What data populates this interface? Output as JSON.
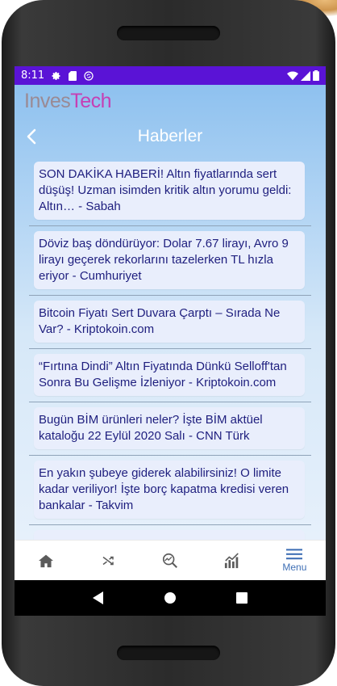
{
  "status": {
    "time": "8:11"
  },
  "app": {
    "brand_part1": "Inves",
    "brand_part2": "Tech",
    "title": "Haberler"
  },
  "news": [
    {
      "text": "SON DAKİKA HABERİ! Altın fiyatlarında sert düşüş! Uzman isimden kritik altın yorumu geldi: Altın… - Sabah"
    },
    {
      "text": "Döviz baş döndürüyor: Dolar 7.67 lirayı, Avro 9 lirayı geçerek rekorlarını tazelerken TL hızla eriyor - Cumhuriyet"
    },
    {
      "text": "Bitcoin Fiyatı Sert Duvara Çarptı – Sırada Ne Var? - Kriptokoin.com"
    },
    {
      "text": "“Fırtına Dindi” Altın Fiyatında Dünkü Selloff'tan Sonra Bu Gelişme İzleniyor - Kriptokoin.com"
    },
    {
      "text": "Bugün BİM ürünleri neler? İşte BİM aktüel kataloğu 22 Eylül 2020 Salı - CNN Türk"
    },
    {
      "text": "En yakın şubeye giderek alabilirsiniz! O limite kadar veriliyor! İşte borç kapatma kredisi veren bankalar - Takvim"
    },
    {
      "text": ""
    }
  ],
  "nav": {
    "menu_label": "Menu",
    "accent": "#3f6fb5"
  },
  "colors": {
    "statusbar": "#5a13d6",
    "card": "#e9eefc",
    "card_text": "#1e1e7e"
  }
}
